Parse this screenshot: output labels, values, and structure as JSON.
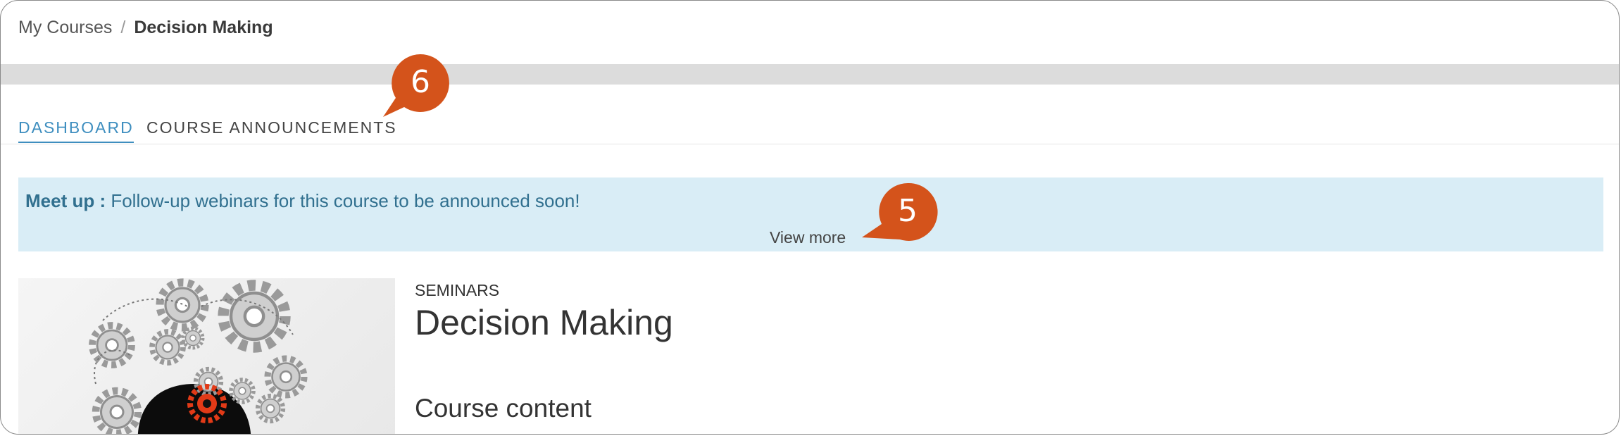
{
  "breadcrumb": {
    "parent": "My Courses",
    "separator": "/",
    "current": "Decision Making"
  },
  "tabs": [
    {
      "label": "DASHBOARD",
      "active": true
    },
    {
      "label": "COURSE ANNOUNCEMENTS",
      "active": false
    }
  ],
  "notice": {
    "label": "Meet up :",
    "message": "Follow-up webinars for this course to be announced soon!",
    "view_more": "View more"
  },
  "course": {
    "category": "SEMINARS",
    "title": "Decision Making",
    "section_heading": "Course content"
  },
  "callouts": [
    {
      "number": "6",
      "color": "#d4531b"
    },
    {
      "number": "5",
      "color": "#d4531b"
    }
  ],
  "colors": {
    "accent": "#3e8ebf",
    "notice_bg": "#d9edf6",
    "notice_text": "#31708f",
    "callout": "#d4531b"
  }
}
